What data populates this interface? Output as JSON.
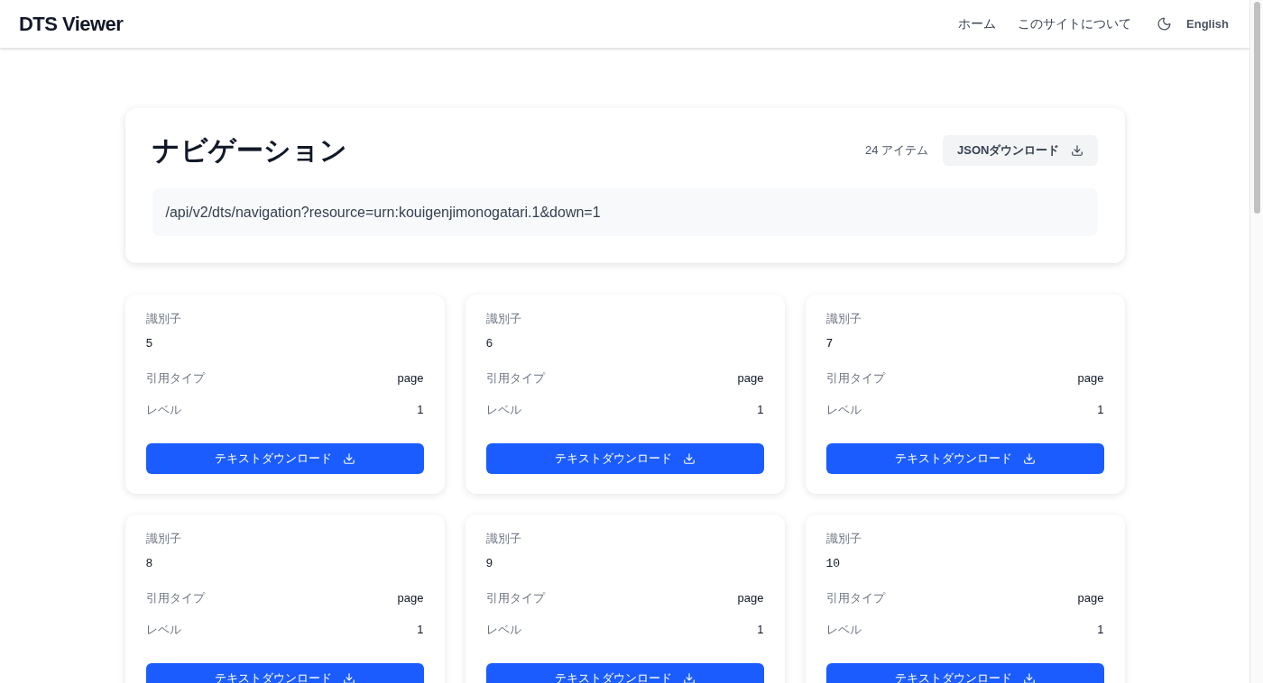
{
  "header": {
    "title": "DTS Viewer",
    "nav": [
      "ホーム",
      "このサイトについて"
    ],
    "language": "English"
  },
  "navigation": {
    "title": "ナビゲーション",
    "count": "24 アイテム",
    "download": "JSONダウンロード",
    "url": "/api/v2/dts/navigation?resource=urn:kouigenjimonogatari.1&down=1"
  },
  "items": [
    {
      "identifier_label": "識別子",
      "identifier": "5",
      "cite_type_label": "引用タイプ",
      "cite_type": "page",
      "level_label": "レベル",
      "level_value": "1",
      "download": "テキストダウンロード"
    },
    {
      "identifier_label": "識別子",
      "identifier": "6",
      "cite_type_label": "引用タイプ",
      "cite_type": "page",
      "level_label": "レベル",
      "level_value": "1",
      "download": "テキストダウンロード"
    },
    {
      "identifier_label": "識別子",
      "identifier": "7",
      "cite_type_label": "引用タイプ",
      "cite_type": "page",
      "level_label": "レベル",
      "level_value": "1",
      "download": "テキストダウンロード"
    },
    {
      "identifier_label": "識別子",
      "identifier": "8",
      "cite_type_label": "引用タイプ",
      "cite_type": "page",
      "level_label": "レベル",
      "level_value": "1",
      "download": "テキストダウンロード"
    },
    {
      "identifier_label": "識別子",
      "identifier": "9",
      "cite_type_label": "引用タイプ",
      "cite_type": "page",
      "level_label": "レベル",
      "level_value": "1",
      "download": "テキストダウンロード"
    },
    {
      "identifier_label": "識別子",
      "identifier": "10",
      "cite_type_label": "引用タイプ",
      "cite_type": "page",
      "level_label": "レベル",
      "level_value": "1",
      "download": "テキストダウンロード"
    }
  ]
}
